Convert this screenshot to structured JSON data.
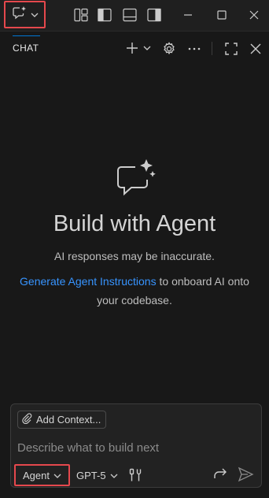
{
  "titlebar": {
    "chat_menu_icon": "chat-sparkle-icon",
    "icons": [
      "customize-layout-icon",
      "toggle-primary-sidebar-icon",
      "toggle-panel-icon",
      "toggle-secondary-sidebar-icon",
      "minimize-icon",
      "maximize-icon",
      "close-icon"
    ]
  },
  "panel": {
    "tab_label": "CHAT",
    "icons": [
      "new-chat-icon",
      "chevron-down-icon",
      "settings-gear-icon",
      "more-actions-icon",
      "maximize-panel-icon",
      "close-panel-icon"
    ]
  },
  "welcome": {
    "icon": "chat-sparkle-icon",
    "title": "Build with Agent",
    "note": "AI responses may be inaccurate.",
    "instructions_link": "Generate Agent Instructions",
    "instructions_rest": " to onboard AI onto your codebase."
  },
  "input": {
    "add_context_label": "Add Context...",
    "placeholder": "Describe what to build next",
    "mode_label": "Agent",
    "model_label": "GPT-5",
    "icons": [
      "paperclip-icon",
      "configure-tools-icon",
      "continue-arrow-icon",
      "send-icon"
    ]
  },
  "colors": {
    "background": "#181818",
    "link": "#3794ff",
    "highlight_border": "#e5484d",
    "tab_underline": "#0078d4"
  }
}
